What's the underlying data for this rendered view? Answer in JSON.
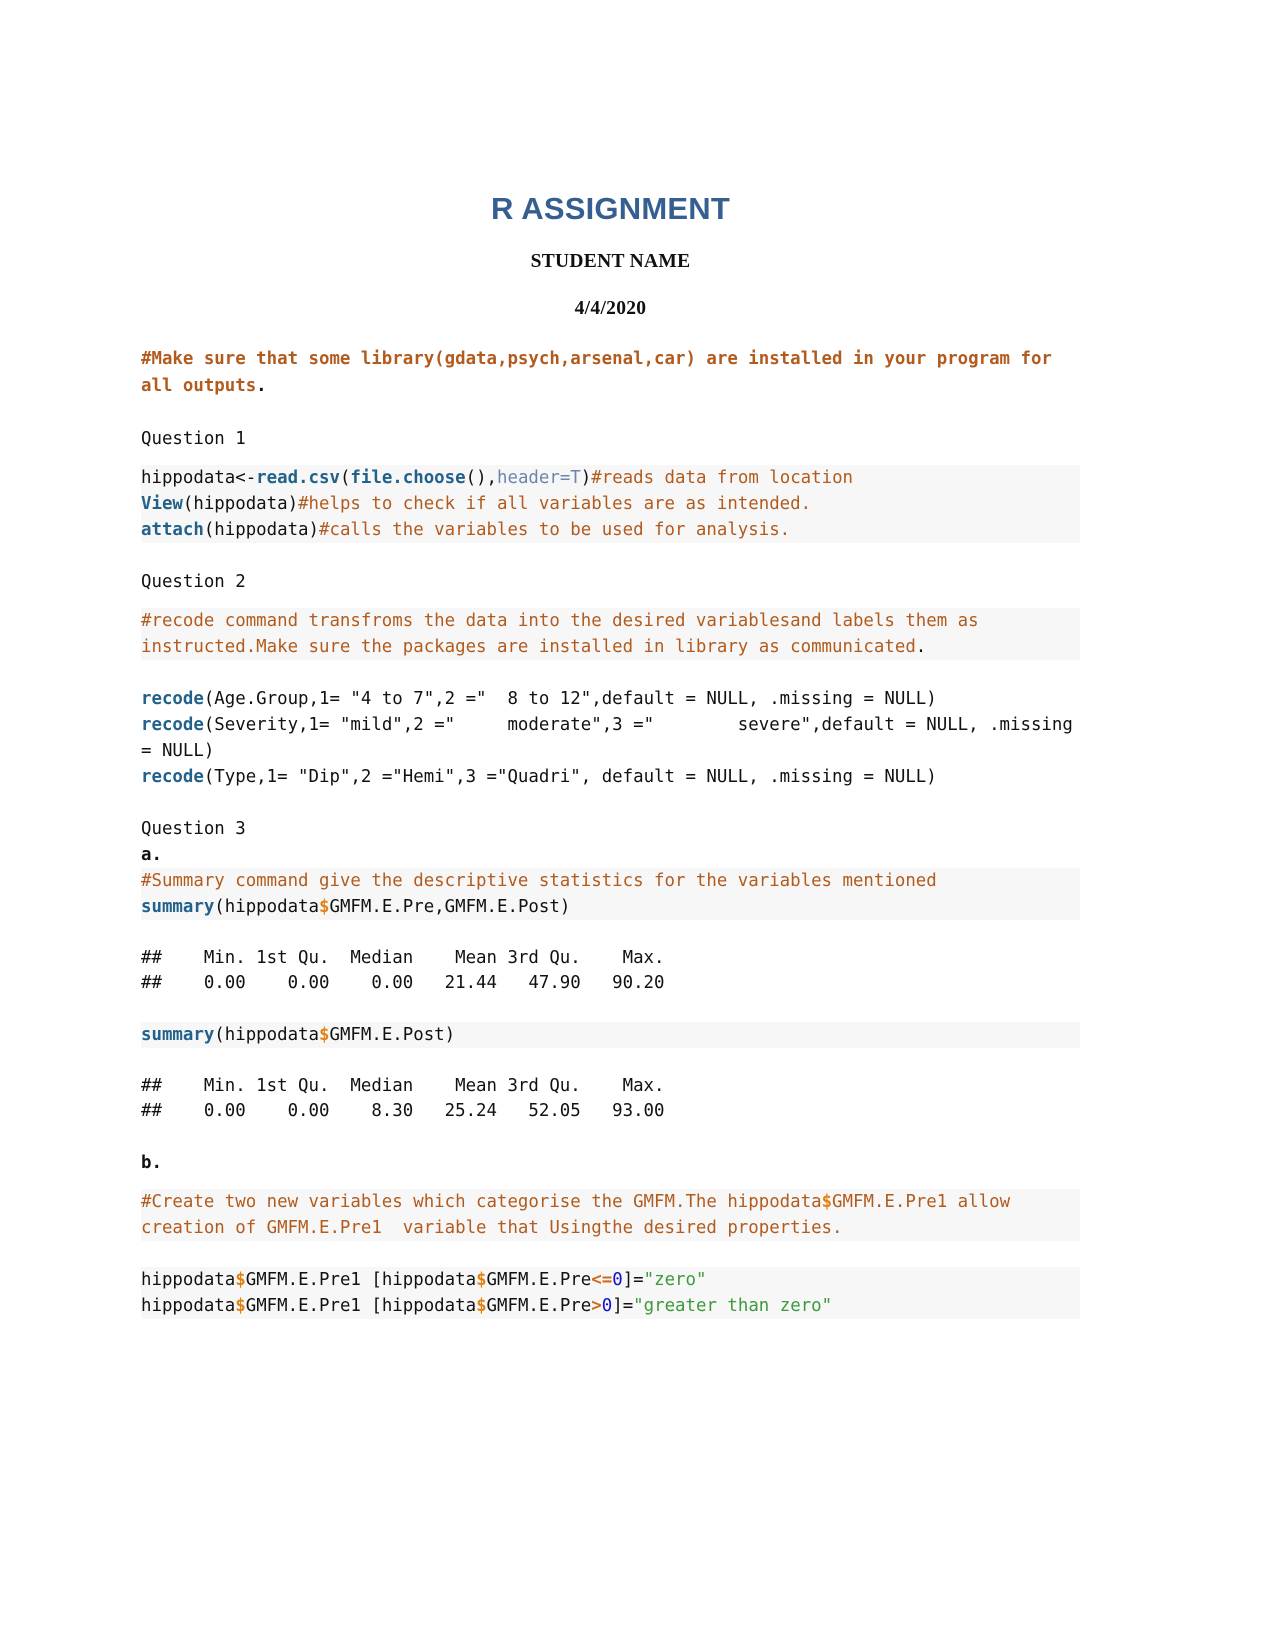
{
  "document": {
    "title": "R ASSIGNMENT",
    "author": "STUDENT NAME",
    "date": "4/4/2020"
  },
  "intro_note": {
    "text": "#Make sure that some library(gdata,psych,arsenal,car) are installed in your program for all outputs",
    "trailing_period": "."
  },
  "sections": {
    "question1": {
      "label": "Question 1",
      "code": {
        "line1": {
          "a": "hippodata<-",
          "fn1": "read.csv",
          "b": "(",
          "fn2": "file.choose",
          "c": "(),",
          "arg": "header=T",
          "d": ")",
          "comment": "#reads data from location"
        },
        "line2": {
          "fn": "View",
          "a": "(hippodata)",
          "comment": "#helps to check if all variables are as intended."
        },
        "line3": {
          "fn": "attach",
          "a": "(hippodata)",
          "comment": "#calls the variables to be used for analysis."
        }
      }
    },
    "question2": {
      "label": "Question 2",
      "comment": "#recode command transfroms the data into the desired variablesand labels them as instructed.Make sure the packages are installed in library as communicated",
      "comment_period": ".",
      "recode_lines": [
        {
          "fn": "recode",
          "rest": "(Age.Group,1= \"4 to 7\",2 =\"  8 to 12\",default = NULL, .missing = NULL)"
        },
        {
          "fn": "recode",
          "rest": "(Severity,1= \"mild\",2 =\"     moderate\",3 =\"        severe\",default = NULL, .missing = NULL)"
        },
        {
          "fn": "recode",
          "rest": "(Type,1= \"Dip\",2 =\"Hemi\",3 =\"Quadri\", default = NULL, .missing = NULL)"
        }
      ]
    },
    "question3": {
      "label": "Question 3",
      "part_a": {
        "marker": "a.",
        "comment": "#Summary command give the descriptive statistics for the variables mentioned",
        "summary1": {
          "fn": "summary",
          "open": "(hippodata",
          "dollar": "$",
          "rest": "GMFM.E.Pre,GMFM.E.Post)"
        },
        "output1": {
          "header": "##    Min. 1st Qu.  Median    Mean 3rd Qu.    Max.",
          "values": "##    0.00    0.00    0.00   21.44   47.90   90.20"
        },
        "summary2": {
          "fn": "summary",
          "open": "(hippodata",
          "dollar": "$",
          "rest": "GMFM.E.Post)"
        },
        "output2": {
          "header": "##    Min. 1st Qu.  Median    Mean 3rd Qu.    Max.",
          "values": "##    0.00    0.00    8.30   25.24   52.05   93.00"
        }
      },
      "part_b": {
        "marker": "b.",
        "comment_seg1": "#Create two new variables which categorise the GMFM.The hippodata",
        "comment_dollar": "$",
        "comment_seg2": "GMFM.E.Pre1 allow creation of GMFM.E.Pre1  variable that Usingthe desired properties.",
        "assign1": {
          "a": "hippodata",
          "d1": "$",
          "b": "GMFM.E.Pre1 [hippodata",
          "d2": "$",
          "c": "GMFM.E.Pre",
          "op": "<=",
          "num": "0",
          "e": "]=",
          "str": "\"zero\""
        },
        "assign2": {
          "a": "hippodata",
          "d1": "$",
          "b": "GMFM.E.Pre1 [hippodata",
          "d2": "$",
          "c": "GMFM.E.Pre",
          "op": ">",
          "num": "0",
          "e": "]=",
          "str": "\"greater than zero\""
        }
      }
    }
  },
  "colors": {
    "title_blue": "#365f91",
    "comment_brown": "#b25b1e",
    "function_blue": "#21618c",
    "arg_blue": "#6b86ae",
    "dollar_orange": "#e08214",
    "string_green": "#3c9a3c",
    "number_blue": "#1010cd",
    "code_background": "#f7f7f7"
  }
}
